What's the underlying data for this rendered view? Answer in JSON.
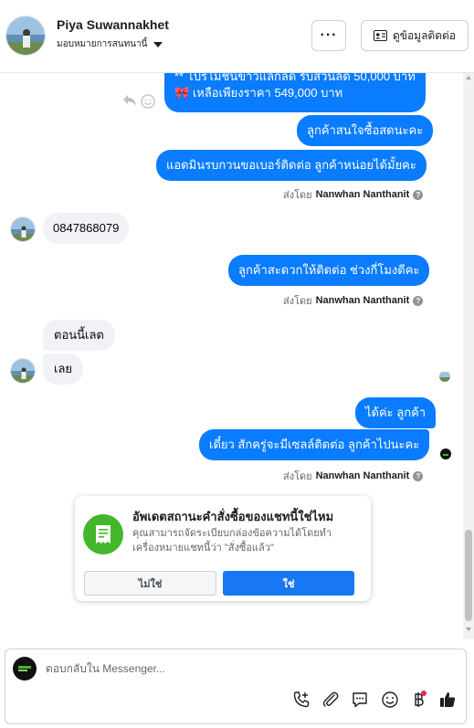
{
  "header": {
    "name": "Piya Suwannakhet",
    "assign_label": "มอบหมายการสนทนานี้",
    "more_label": "···",
    "contact_label": "ดูข้อมูลติดต่อ"
  },
  "messages": {
    "m1_line1": "** โปรโมชั่นข้าวแลกลด รับส่วนลด 50,000 บาท",
    "m1_line2": "เหลือเพียงราคา 549,000 บาท",
    "m1_emoji": "🎀",
    "m2": "ลูกค้าสนใจซื้อสดนะคะ",
    "m3": "แอดมินรบกวนขอเบอร์ติดต่อ ลูกค้าหน่อยได้มั้ยคะ",
    "m4": "0847868079",
    "m5": "ลูกค้าสะดวกให้ติดต่อ ช่วงกี่โมงดีคะ",
    "m6": "ตอนนี้เลต",
    "m7": "เลย",
    "m8": "ได้ค่ะ ลูกค้า",
    "m9": "เดี๋ยว สักครู่จะมีเซลล์ติดต่อ ลูกค้าไปนะคะ"
  },
  "sent_by": {
    "prefix": "ส่งโดย",
    "agent": "Nanwhan Nanthanit",
    "help": "?"
  },
  "status_card": {
    "title": "อัพเดตสถานะคำสั่งซื้อของแชทนี้ใช่ไหม",
    "body": "คุณสามารถจัดระเบียบกล่องข้อความได้โดยทำเครื่องหมายแชทนี้ว่า \"สั่งซื้อแล้ว\"",
    "no_label": "ไม่ใช่",
    "yes_label": "ใช่"
  },
  "composer": {
    "placeholder": "ตอบกลับใน Messenger..."
  },
  "colors": {
    "outgoing_bubble": "#0a7cff",
    "incoming_bubble": "#f0f2f5",
    "primary_button": "#1877f2",
    "card_icon": "#42b72a",
    "notification_dot": "#f02849"
  },
  "icons": [
    "reply-icon",
    "smile-icon",
    "contact-card-icon",
    "receipt-icon",
    "add-call-icon",
    "attachment-icon",
    "saved-reply-icon",
    "emoji-icon",
    "baht-icon",
    "thumbs-up-icon",
    "help-icon"
  ]
}
